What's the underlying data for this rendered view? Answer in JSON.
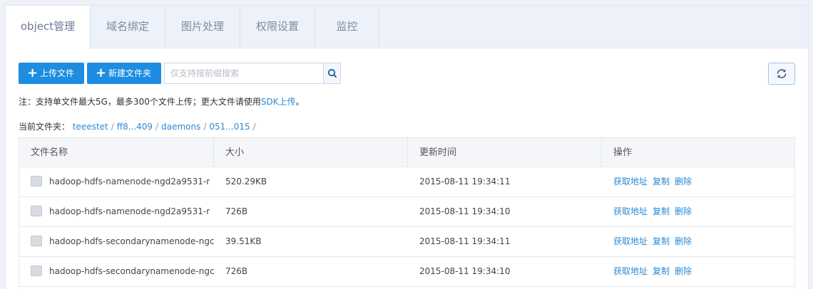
{
  "tabs": [
    {
      "label": "object管理"
    },
    {
      "label": "域名绑定"
    },
    {
      "label": "图片处理"
    },
    {
      "label": "权限设置"
    },
    {
      "label": "监控"
    }
  ],
  "toolbar": {
    "upload_label": "上传文件",
    "new_folder_label": "新建文件夹",
    "search_placeholder": "仅支持按前缀搜索"
  },
  "note": {
    "text": "注：支持单文件最大5G，最多300个文件上传；更大文件请使用",
    "link": "SDK上传",
    "suffix": "。"
  },
  "breadcrumb": {
    "label": "当前文件夹：",
    "items": [
      "teeestet",
      "ff8...409",
      "daemons",
      "051...015"
    ]
  },
  "table": {
    "headers": [
      "文件名称",
      "大小",
      "更新时间",
      "操作"
    ],
    "rows": [
      {
        "name": "hadoop-hdfs-namenode-ngd2a9531-r",
        "size": "520.29KB",
        "time": "2015-08-11 19:34:11"
      },
      {
        "name": "hadoop-hdfs-namenode-ngd2a9531-r",
        "size": "726B",
        "time": "2015-08-11 19:34:10"
      },
      {
        "name": "hadoop-hdfs-secondarynamenode-ngc",
        "size": "39.51KB",
        "time": "2015-08-11 19:34:11"
      },
      {
        "name": "hadoop-hdfs-secondarynamenode-ngc",
        "size": "726B",
        "time": "2015-08-11 19:34:10"
      }
    ],
    "actions": [
      "获取地址",
      "复制",
      "删除"
    ]
  },
  "icons": {
    "plus": "plus-icon",
    "search": "search-icon",
    "refresh": "refresh-icon",
    "file": "file-cloud-icon"
  },
  "colors": {
    "accent": "#1c8de0",
    "link": "#2b8ad6",
    "tab_bg": "#edf1f9"
  }
}
